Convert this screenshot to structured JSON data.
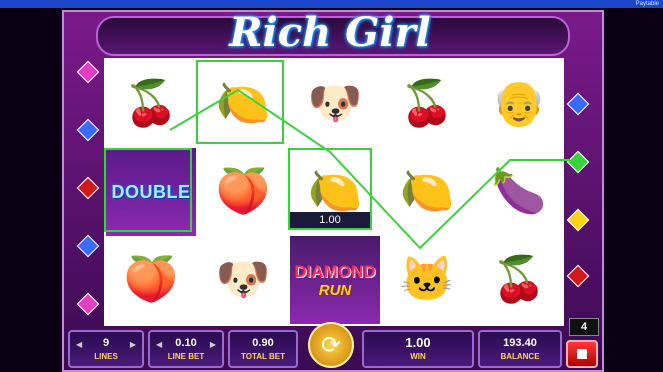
{
  "topbar": {
    "label": "Paytable"
  },
  "game": {
    "title": "Rich Girl"
  },
  "reels": [
    [
      "cherries",
      "double",
      "peach"
    ],
    [
      "lemon",
      "peach",
      "dog"
    ],
    [
      "dog",
      "lemon",
      "diamond_run"
    ],
    [
      "cherries",
      "lemon",
      "cat"
    ],
    [
      "man",
      "plum",
      "cherries"
    ]
  ],
  "symbols": {
    "double_text": "DOUBLE",
    "diamond_run_line1": "DIAMOND",
    "diamond_run_line2": "RUN"
  },
  "win_line_amount": "1.00",
  "controls": {
    "lines_value": "9",
    "lines_label": "LINES",
    "line_bet_value": "0.10",
    "line_bet_label": "LINE BET",
    "total_bet_value": "0.90",
    "total_bet_label": "TOTAL BET",
    "win_value": "1.00",
    "win_label": "WIN",
    "balance_value": "193.40",
    "balance_label": "BALANCE",
    "autoplay_count": "4"
  },
  "colors": {
    "win_line": "#3ad23a",
    "accent": "#ffd84a"
  }
}
